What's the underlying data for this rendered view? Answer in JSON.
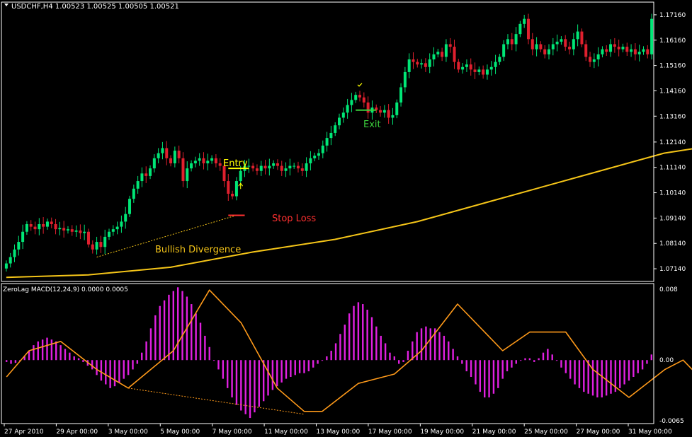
{
  "window": {
    "symbol_header": "USDCHF,H4  1.00523 1.00525 1.00505 1.00521",
    "indicator_header": "ZeroLag MACD(12,24,9) 0.0000 0.0005"
  },
  "colors": {
    "background": "#000000",
    "bull_candle": "#00e676",
    "bear_candle": "#e0202e",
    "moving_average": "#f5c518",
    "histogram": "#e020e0",
    "signal_line": "#ff9a1a",
    "axis_text": "#ffffff",
    "entry_label": "#ffff00",
    "exit_label": "#3ccf3c",
    "stop_loss_label": "#ff3030",
    "divergence_label": "#f5c518"
  },
  "annotations": {
    "entry": "Entry",
    "exit": "Exit",
    "stop_loss": "Stop Loss",
    "divergence": "Bullish Divergence"
  },
  "chart_data": [
    {
      "type": "candlestick",
      "symbol": "USDCHF",
      "timeframe": "H4",
      "ylim": [
        1.0664,
        1.1766
      ],
      "y_ticks": [
        "1.17160",
        "1.16160",
        "1.15160",
        "1.14160",
        "1.13160",
        "1.12140",
        "1.11140",
        "1.10140",
        "1.09140",
        "1.08140",
        "1.07140"
      ],
      "x_ticks": [
        "27 Apr 2010",
        "29 Apr 00:00",
        "3 May 00:00",
        "5 May 00:00",
        "7 May 00:00",
        "11 May 00:00",
        "13 May 00:00",
        "17 May 00:00",
        "19 May 00:00",
        "21 May 00:00",
        "25 May 00:00",
        "27 May 00:00",
        "31 May 00:00"
      ],
      "closes": [
        1.0735,
        1.076,
        1.079,
        1.082,
        1.086,
        1.089,
        1.088,
        1.087,
        1.089,
        1.088,
        1.09,
        1.089,
        1.087,
        1.0875,
        1.0865,
        1.087,
        1.086,
        1.0865,
        1.0855,
        1.086,
        1.081,
        1.079,
        1.082,
        1.08,
        1.084,
        1.086,
        1.087,
        1.088,
        1.09,
        1.093,
        1.099,
        1.103,
        1.106,
        1.109,
        1.108,
        1.111,
        1.115,
        1.117,
        1.119,
        1.115,
        1.113,
        1.118,
        1.115,
        1.106,
        1.111,
        1.113,
        1.114,
        1.115,
        1.113,
        1.114,
        1.115,
        1.113,
        1.112,
        1.106,
        1.101,
        1.1,
        1.106,
        1.11,
        1.112,
        1.112,
        1.111,
        1.11,
        1.112,
        1.111,
        1.112,
        1.113,
        1.112,
        1.11,
        1.111,
        1.112,
        1.112,
        1.111,
        1.11,
        1.113,
        1.115,
        1.116,
        1.117,
        1.12,
        1.123,
        1.125,
        1.128,
        1.131,
        1.133,
        1.136,
        1.138,
        1.14,
        1.139,
        1.137,
        1.133,
        1.135,
        1.134,
        1.133,
        1.134,
        1.131,
        1.132,
        1.137,
        1.143,
        1.149,
        1.154,
        1.153,
        1.152,
        1.1525,
        1.151,
        1.154,
        1.156,
        1.157,
        1.155,
        1.16,
        1.159,
        1.153,
        1.15,
        1.151,
        1.152,
        1.15,
        1.149,
        1.15,
        1.148,
        1.15,
        1.151,
        1.153,
        1.155,
        1.16,
        1.162,
        1.16,
        1.164,
        1.168,
        1.17,
        1.162,
        1.158,
        1.16,
        1.158,
        1.156,
        1.158,
        1.16,
        1.161,
        1.162,
        1.159,
        1.158,
        1.162,
        1.165,
        1.16,
        1.155,
        1.153,
        1.154,
        1.156,
        1.158,
        1.157,
        1.16,
        1.159,
        1.158,
        1.159,
        1.157,
        1.158,
        1.156,
        1.157,
        1.158,
        1.156,
        1.17
      ],
      "moving_average": [
        [
          0,
          1.068
        ],
        [
          20,
          1.069
        ],
        [
          40,
          1.072
        ],
        [
          60,
          1.078
        ],
        [
          80,
          1.083
        ],
        [
          100,
          1.09
        ],
        [
          120,
          1.099
        ],
        [
          140,
          1.108
        ],
        [
          160,
          1.117
        ],
        [
          180,
          1.122
        ]
      ]
    },
    {
      "type": "histogram+line",
      "name": "ZeroLag MACD(12,24,9)",
      "ylim": [
        -0.0068,
        0.0082
      ],
      "y_ticks": [
        "0.008",
        "0.00",
        "-0.0065"
      ],
      "histogram": [
        -0.0002,
        -0.0004,
        -0.0003,
        0.0,
        0.0004,
        0.001,
        0.0016,
        0.002,
        0.0022,
        0.0024,
        0.0022,
        0.002,
        0.0016,
        0.0012,
        0.0008,
        0.0004,
        0.0002,
        -0.0002,
        -0.0006,
        -0.001,
        -0.0016,
        -0.0022,
        -0.0026,
        -0.003,
        -0.0028,
        -0.0024,
        -0.002,
        -0.0016,
        -0.001,
        -0.0004,
        0.0008,
        0.002,
        0.0034,
        0.0048,
        0.0058,
        0.0064,
        0.007,
        0.0074,
        0.0078,
        0.0074,
        0.0068,
        0.006,
        0.005,
        0.004,
        0.0026,
        0.0014,
        0.0,
        -0.001,
        -0.002,
        -0.003,
        -0.004,
        -0.0048,
        -0.0054,
        -0.0058,
        -0.0062,
        -0.0056,
        -0.005,
        -0.0044,
        -0.0038,
        -0.0032,
        -0.0028,
        -0.0024,
        -0.002,
        -0.0018,
        -0.0016,
        -0.0014,
        -0.0014,
        -0.0012,
        -0.0008,
        -0.0004,
        0.0,
        0.0004,
        0.001,
        0.0018,
        0.0028,
        0.0038,
        0.005,
        0.0058,
        0.0062,
        0.006,
        0.0054,
        0.0046,
        0.0036,
        0.0026,
        0.0018,
        0.0008,
        0.0004,
        -0.0004,
        -0.0002,
        0.001,
        0.002,
        0.003,
        0.0034,
        0.0036,
        0.0034,
        0.0034,
        0.003,
        0.0026,
        0.002,
        0.0012,
        0.0004,
        -0.0004,
        -0.0012,
        -0.0018,
        -0.0026,
        -0.0034,
        -0.004,
        -0.004,
        -0.0036,
        -0.003,
        -0.002,
        -0.0012,
        -0.0008,
        -0.0004,
        0.0,
        0.0002,
        0.0002,
        -0.0002,
        0.0002,
        0.0008,
        0.0012,
        0.0006,
        0.0,
        -0.0008,
        -0.0014,
        -0.002,
        -0.0026,
        -0.003,
        -0.0034,
        -0.0036,
        -0.0038,
        -0.004,
        -0.004,
        -0.0038,
        -0.0036,
        -0.0034,
        -0.003,
        -0.0026,
        -0.0022,
        -0.0018,
        -0.0014,
        -0.001,
        -0.0004,
        0.0006
      ],
      "signal_line": [
        [
          0,
          -0.0018
        ],
        [
          5,
          0.001
        ],
        [
          12,
          0.002
        ],
        [
          20,
          -0.001
        ],
        [
          27,
          -0.003
        ],
        [
          37,
          0.001
        ],
        [
          45,
          0.0075
        ],
        [
          52,
          0.004
        ],
        [
          60,
          -0.003
        ],
        [
          66,
          -0.0055
        ],
        [
          70,
          -0.0055
        ],
        [
          78,
          -0.0025
        ],
        [
          86,
          -0.0015
        ],
        [
          92,
          0.001
        ],
        [
          100,
          0.006
        ],
        [
          106,
          0.003
        ],
        [
          110,
          0.001
        ],
        [
          116,
          0.003
        ],
        [
          124,
          0.003
        ],
        [
          130,
          -0.001
        ],
        [
          138,
          -0.004
        ],
        [
          146,
          -0.001
        ],
        [
          150,
          0.0
        ],
        [
          156,
          -0.003
        ],
        [
          162,
          -0.004
        ],
        [
          170,
          -0.0038
        ],
        [
          176,
          -0.002
        ],
        [
          182,
          -0.0005
        ],
        [
          186,
          0.0005
        ]
      ]
    }
  ]
}
